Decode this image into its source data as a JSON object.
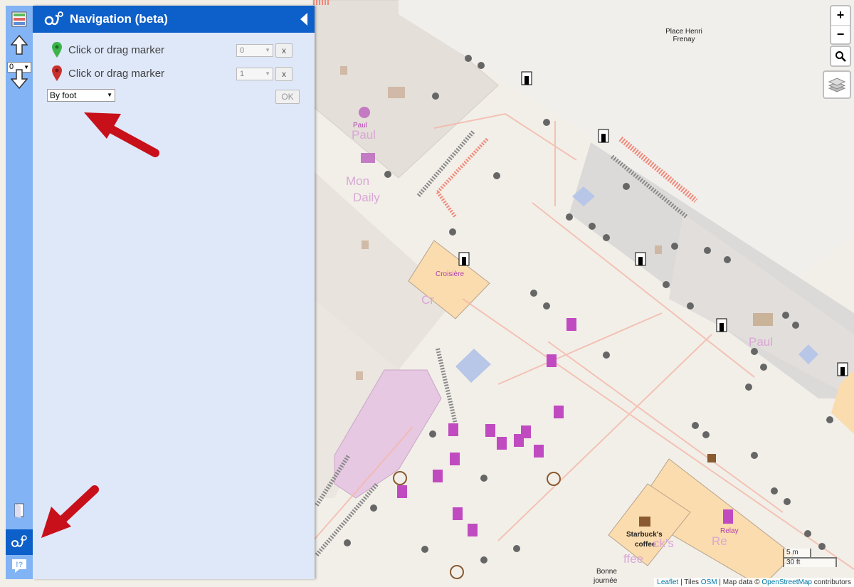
{
  "panel": {
    "title": "Navigation (beta)",
    "marker_from": {
      "label": "Click or drag marker",
      "level": "0",
      "clear": "x"
    },
    "marker_to": {
      "label": "Click or drag marker",
      "level": "1",
      "clear": "x"
    },
    "mode": {
      "selected": "By foot"
    },
    "ok_label": "OK"
  },
  "levelbar": {
    "level_selected": "0"
  },
  "map": {
    "place_label_line1": "Place Henri",
    "place_label_line2": "Frenay",
    "labels": {
      "paul_top": "Paul",
      "paul_big": "Paul",
      "monop_daily_1": "Mon",
      "monop_daily_2": "Daily",
      "croisiere": "Croisière",
      "paul_right": "Paul",
      "starbucks": "Starbuck's",
      "starbucks2": "coffee",
      "starbucks_bg": "ck's",
      "starbucks_bg2": "ffee",
      "relay": "Relay",
      "relay_bg": "Re",
      "bonne1": "Bonne",
      "bonne2": "journée",
      "cr_bg": "Cr"
    }
  },
  "controls": {
    "zoom_in": "+",
    "zoom_out": "−"
  },
  "scale": {
    "metric": "5 m",
    "imperial": "30 ft"
  },
  "attribution": {
    "leaflet": "Leaflet",
    "sep1": " | Tiles ",
    "osm": "OSM",
    "sep2": " | Map data © ",
    "openstreetmap": "OpenStreetMap",
    "contributors": " contributors"
  },
  "colors": {
    "accent": "#0d5fc9",
    "panel_bg": "#dfe8f9",
    "levelbar": "#82b4f5"
  }
}
